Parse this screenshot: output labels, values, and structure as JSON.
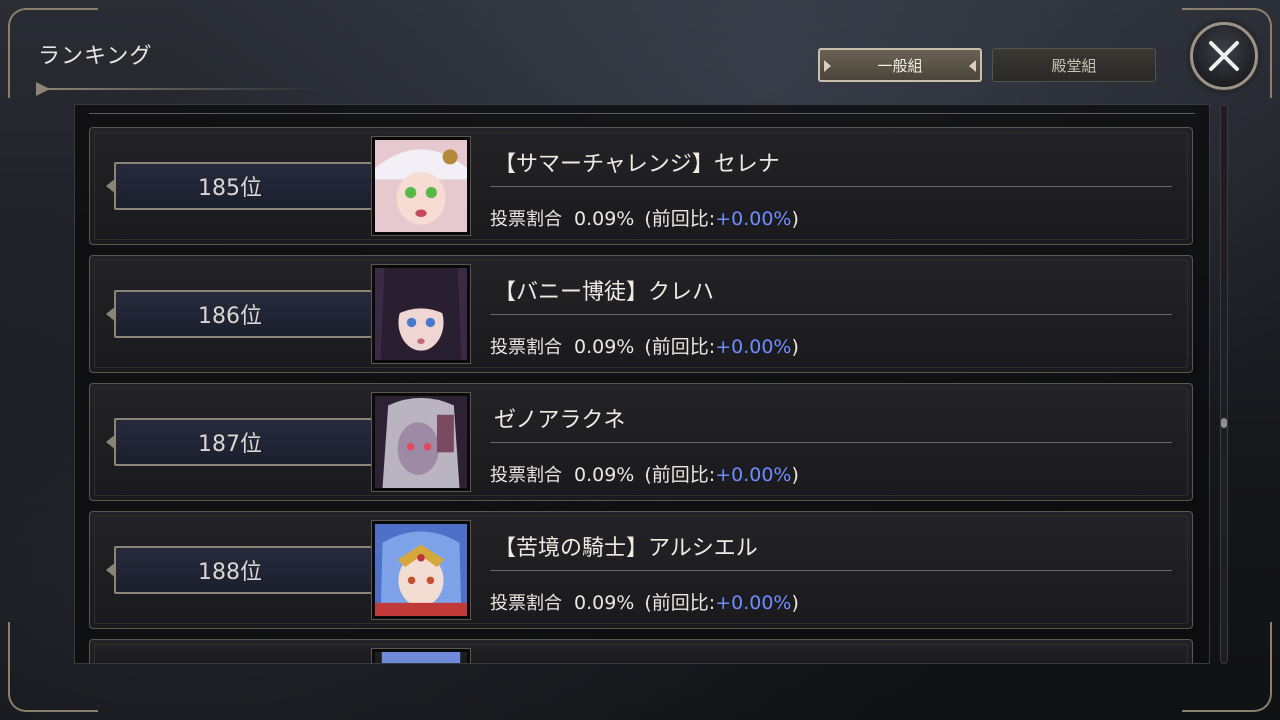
{
  "screen": {
    "title": "ランキング",
    "tabs": [
      {
        "label": "一般組",
        "active": true
      },
      {
        "label": "殿堂組",
        "active": false
      }
    ],
    "close_icon": "close-x-icon"
  },
  "rankings": [
    {
      "rank": "185位",
      "name": "【サマーチャレンジ】セレナ",
      "vote_label": "投票割合",
      "vote_pct": "0.09%",
      "prev_open": "(前回比:",
      "prev_delta": "+0.00%",
      "prev_close": ")",
      "portrait_color": "#d8a8b0"
    },
    {
      "rank": "186位",
      "name": "【バニー博徒】クレハ",
      "vote_label": "投票割合",
      "vote_pct": "0.09%",
      "prev_open": "(前回比:",
      "prev_delta": "+0.00%",
      "prev_close": ")",
      "portrait_color": "#3a2b3e"
    },
    {
      "rank": "187位",
      "name": "ゼノアラクネ",
      "vote_label": "投票割合",
      "vote_pct": "0.09%",
      "prev_open": "(前回比:",
      "prev_delta": "+0.00%",
      "prev_close": ")",
      "portrait_color": "#4a3c52"
    },
    {
      "rank": "188位",
      "name": "【苦境の騎士】アルシエル",
      "vote_label": "投票割合",
      "vote_pct": "0.09%",
      "prev_open": "(前回比:",
      "prev_delta": "+0.00%",
      "prev_close": ")",
      "portrait_color": "#5a7ed0"
    }
  ],
  "colors": {
    "delta_accent": "#6f8cff",
    "frame_gold": "#8b8576"
  }
}
